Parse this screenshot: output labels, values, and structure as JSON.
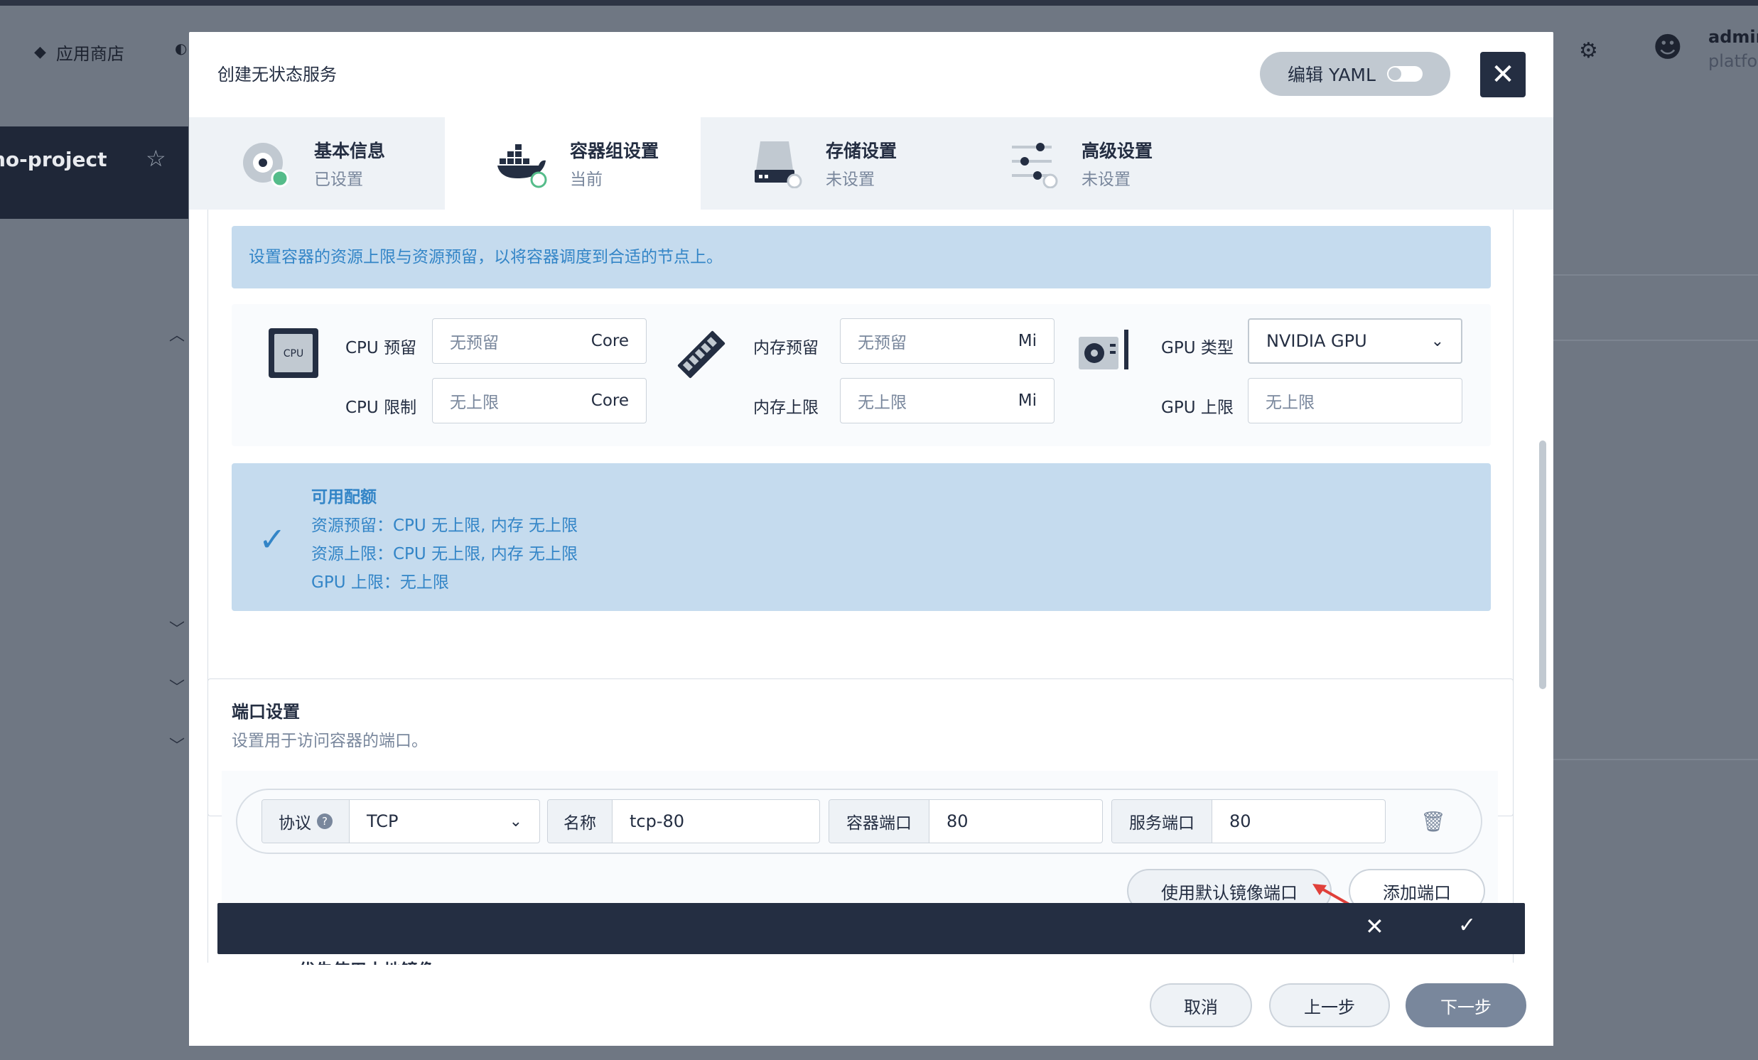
{
  "background": {
    "nav_app_store": "应用商店",
    "project_name": "no-project",
    "user_name": "admin",
    "user_role": "platfor"
  },
  "modal": {
    "title": "创建无状态服务",
    "edit_yaml_label": "编辑 YAML",
    "close_label": "✕"
  },
  "tabs": [
    {
      "title": "基本信息",
      "status": "已设置"
    },
    {
      "title": "容器组设置",
      "status": "当前"
    },
    {
      "title": "存储设置",
      "status": "未设置"
    },
    {
      "title": "高级设置",
      "status": "未设置"
    }
  ],
  "resources": {
    "info": "设置容器的资源上限与资源预留，以将容器调度到合适的节点上。",
    "cpu_icon_text": "CPU",
    "cpu_reserve_label": "CPU 预留",
    "cpu_reserve_placeholder": "无预留",
    "cpu_limit_label": "CPU 限制",
    "cpu_limit_placeholder": "无上限",
    "cpu_unit": "Core",
    "mem_reserve_label": "内存预留",
    "mem_reserve_placeholder": "无预留",
    "mem_limit_label": "内存上限",
    "mem_limit_placeholder": "无上限",
    "mem_unit": "Mi",
    "gpu_type_label": "GPU 类型",
    "gpu_type_value": "NVIDIA GPU",
    "gpu_limit_label": "GPU 上限",
    "gpu_limit_placeholder": "无上限"
  },
  "quota": {
    "title": "可用配额",
    "line1": "资源预留：CPU 无上限, 内存 无上限",
    "line2": "资源上限：CPU 无上限, 内存 无上限",
    "line3": "GPU 上限：无上限"
  },
  "ports": {
    "title": "端口设置",
    "subtitle": "设置用于访问容器的端口。",
    "protocol_label": "协议",
    "protocol_value": "TCP",
    "name_label": "名称",
    "name_value": "tcp-80",
    "container_port_label": "容器端口",
    "container_port_value": "80",
    "service_port_label": "服务端口",
    "service_port_value": "80",
    "use_default_label": "使用默认镜像端口",
    "add_port_label": "添加端口"
  },
  "truncated_option": "优先使用本地镜像",
  "footer": {
    "cancel": "取消",
    "prev": "上一步",
    "next": "下一步"
  },
  "colors": {
    "accent_blue": "#3385c7",
    "dark": "#242e42",
    "arrow_red": "#e0403a",
    "status_green": "#55bc8a"
  }
}
